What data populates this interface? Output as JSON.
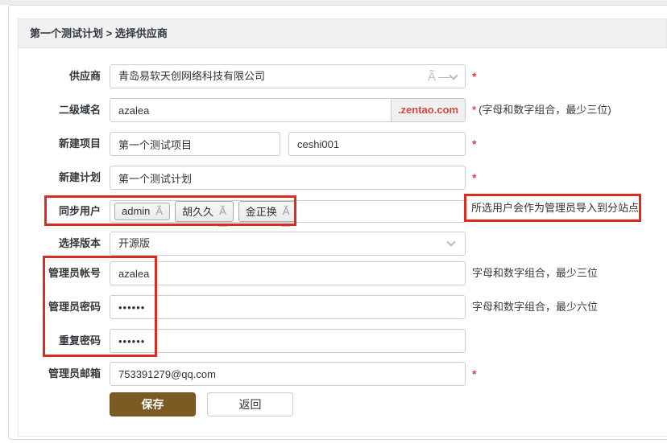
{
  "page": {
    "breadcrumb": "第一个测试计划 > 选择供应商"
  },
  "form": {
    "supplier": {
      "label": "供应商",
      "value": "青岛易软天创网络科技有限公司",
      "dropdown_glyph": "Ã",
      "required_mark": "*"
    },
    "subdomain": {
      "label": "二级域名",
      "value": "azalea",
      "suffix": ".zentao.com",
      "required_mark": "*",
      "hint": "(字母和数字组合，最少三位)"
    },
    "new_project": {
      "label": "新建项目",
      "name_value": "第一个测试项目",
      "code_value": "ceshi001",
      "required_mark": "*"
    },
    "new_plan": {
      "label": "新建计划",
      "value": "第一个测试计划",
      "required_mark": "*"
    },
    "sync_users": {
      "label": "同步用户",
      "tags": [
        "admin",
        "胡久久",
        "金正换"
      ],
      "tag_close_glyph": "Ã",
      "note": "所选用户会作为管理员导入到分站点"
    },
    "version": {
      "label": "选择版本",
      "value": "开源版"
    },
    "admin_account": {
      "label": "管理员帐号",
      "value": "azalea",
      "hint": "字母和数字组合，最少三位"
    },
    "admin_password": {
      "label": "管理员密码",
      "value": "••••••",
      "hint": "字母和数字组合，最少六位"
    },
    "repeat_password": {
      "label": "重复密码",
      "value": "••••••"
    },
    "admin_email": {
      "label": "管理员邮箱",
      "value": "753391279@qq.com",
      "required_mark": "*"
    },
    "buttons": {
      "save": "保存",
      "back": "返回"
    }
  },
  "colors": {
    "save_button": "#7d5a21",
    "required_mark": "#e34040",
    "suffix_text": "#d64541",
    "annotation_box": "#dd2b20",
    "header_bg": "#f1f1f1"
  }
}
